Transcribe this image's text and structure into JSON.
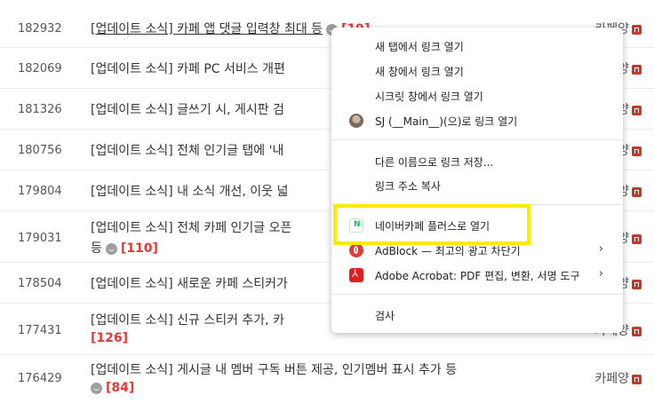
{
  "rows": [
    {
      "num": "182932",
      "title": "[업데이트 소식] 카페 앱 댓글 입력창 최대 등",
      "count": "[19]",
      "author": "카페양"
    },
    {
      "num": "182069",
      "title": "[업데이트 소식] 카페 PC 서비스 개편",
      "author": "카페양"
    },
    {
      "num": "181326",
      "title": "[업데이트 소식] 글쓰기 시, 게시판 검",
      "author": "카페양"
    },
    {
      "num": "180756",
      "title": "[업데이트 소식] 전체 인기글 탭에 '내",
      "author": "카페양"
    },
    {
      "num": "179804",
      "title": "[업데이트 소식] 내 소식 개선, 이웃 넓",
      "author": "카페양"
    },
    {
      "num": "179031",
      "title": "[업데이트 소식] 전체 카페 인기글 오픈",
      "line2": "등",
      "count": "[110]",
      "author": "카페양"
    },
    {
      "num": "178504",
      "title": "[업데이트 소식] 새로운 카페 스티커가",
      "author": "카페양"
    },
    {
      "num": "177431",
      "title": "[업데이트 소식] 신규 스티커 추가, 카",
      "count": "[126]",
      "author": "카페양"
    },
    {
      "num": "176429",
      "title": "[업데이트 소식] 게시글 내 멤버 구독 버튼 제공, 인기멤버 표시 추가 등",
      "count": "[84]",
      "author": "카페양"
    }
  ],
  "menu": {
    "open_new_tab": "새 탭에서 링크 열기",
    "open_new_window": "새 창에서 링크 열기",
    "open_incognito": "시크릿 창에서 링크 열기",
    "open_as_profile": "SJ (__Main__)(으)로 링크 열기",
    "save_link_as": "다른 이름으로 링크 저장...",
    "copy_link": "링크 주소 복사",
    "open_naver_cafe_plus": "네이버카페 플러스로 열기",
    "adblock": "AdBlock — 최고의 광고 차단기",
    "acrobat": "Adobe Acrobat: PDF 편집, 변환, 서명 도구",
    "inspect": "검사"
  },
  "colors": {
    "count_red": "#e53935",
    "highlight": "#ffeb00"
  }
}
